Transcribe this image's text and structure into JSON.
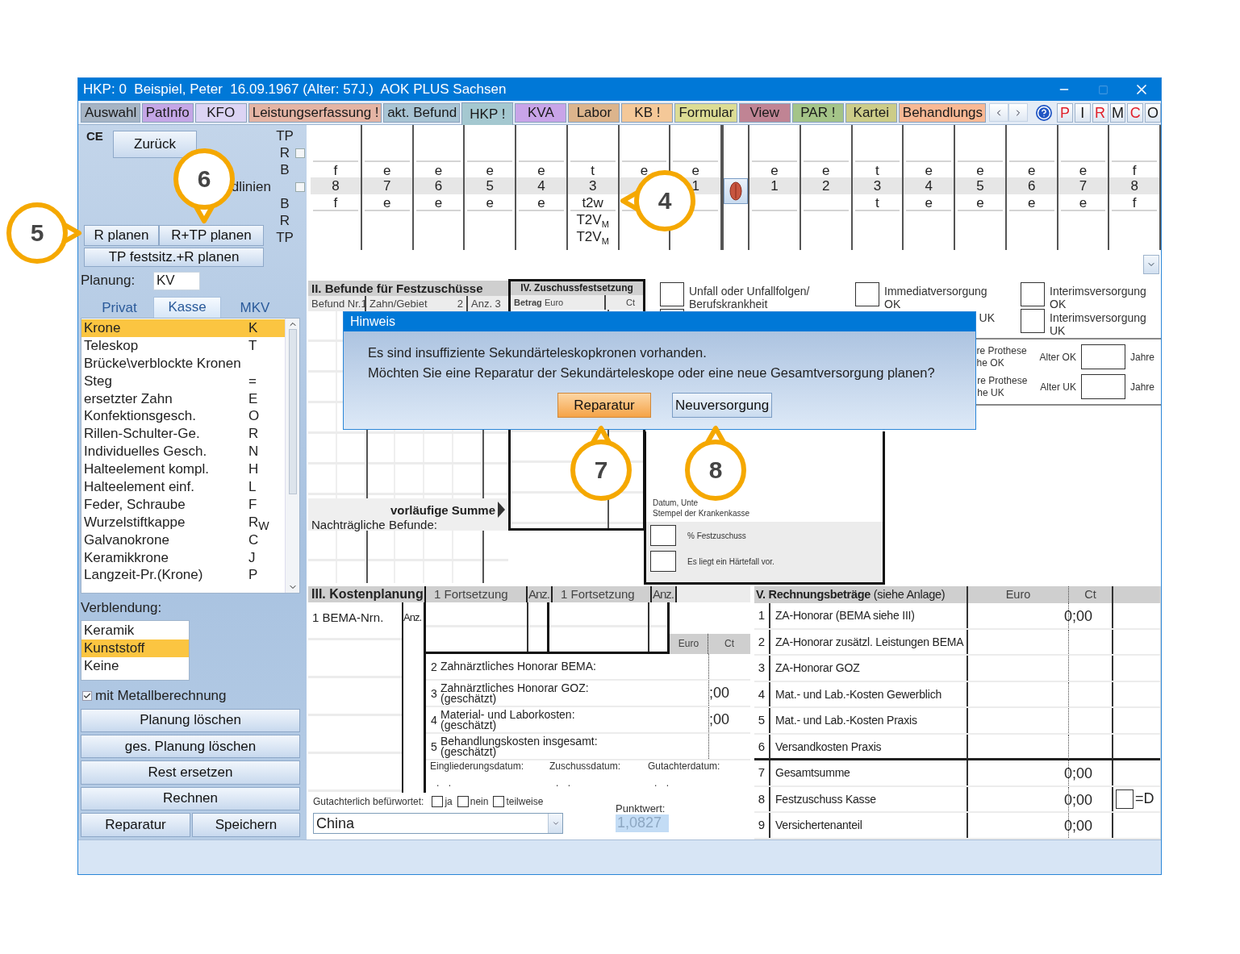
{
  "window": {
    "title": "HKP: 0  Beispiel, Peter  16.09.1967 (Alter: 57J.)  AOK PLUS Sachsen"
  },
  "tabs": [
    {
      "label": "Auswahl",
      "color": "#a6b4c4",
      "selected": false
    },
    {
      "label": "PatInfo",
      "color": "#c4a6e6",
      "selected": false
    },
    {
      "label": "KFO",
      "color": "#dcd4f4",
      "selected": false
    },
    {
      "label": "Leistungserfassung !",
      "color": "#e4b4a4",
      "selected": false
    },
    {
      "label": "akt. Befund",
      "color": "#a8c4d4",
      "selected": false
    },
    {
      "label": "HKP !",
      "color": "#a4c8d0",
      "selected": true
    },
    {
      "label": "KVA",
      "color": "#c8a4e8",
      "selected": false
    },
    {
      "label": "Labor",
      "color": "#dcb48c",
      "selected": false
    },
    {
      "label": "KB !",
      "color": "#f4c898",
      "selected": false
    },
    {
      "label": "Formular",
      "color": "#dcdc94",
      "selected": false
    },
    {
      "label": "View",
      "color": "#c08494",
      "selected": false
    },
    {
      "label": "PAR !",
      "color": "#a4c488",
      "selected": false
    },
    {
      "label": "Kartei",
      "color": "#cccc88",
      "selected": false
    },
    {
      "label": "Behandlungs",
      "color": "#f8b894",
      "selected": false
    }
  ],
  "quick_buttons": [
    {
      "label": "P",
      "color": "#e0202a"
    },
    {
      "label": "I",
      "color": "#1a1a1a"
    },
    {
      "label": "R",
      "color": "#e0202a"
    },
    {
      "label": "M",
      "color": "#1a1a1a"
    },
    {
      "label": "C",
      "color": "#e0202a"
    },
    {
      "label": "O",
      "color": "#1a1a1a"
    }
  ],
  "left_panel": {
    "ce_mark": "CE",
    "back_button": "Zurück",
    "side_labels_top": [
      "TP",
      "R",
      "B"
    ],
    "guide_lines": "dlinien",
    "side_labels_bottom": [
      "B",
      "R",
      "TP"
    ],
    "row_checks": [
      {
        "checked": false
      },
      {
        "checked": false
      }
    ],
    "plan_buttons": [
      "R planen",
      "R+TP planen"
    ],
    "plan_wide_button": "TP festsitz.+R planen",
    "planung": {
      "label": "Planung:",
      "value": "KV"
    },
    "payer_tabs": [
      {
        "label": "Privat",
        "selected": false
      },
      {
        "label": "Kasse",
        "selected": true
      },
      {
        "label": "MKV",
        "selected": false
      }
    ],
    "crown_types": [
      {
        "label": "Krone",
        "code": "K",
        "selected": true
      },
      {
        "label": "Teleskop",
        "code": "T",
        "selected": false
      },
      {
        "label": "Brücke\\verblockte Kronen",
        "selected": false
      },
      {
        "label": "Steg",
        "code": "=",
        "selected": false
      },
      {
        "label": "ersetzter Zahn",
        "code": "E",
        "selected": false
      },
      {
        "label": "Konfektionsgesch.",
        "code": "O",
        "selected": false
      },
      {
        "label": "Rillen-Schulter-Ge.",
        "code": "R",
        "selected": false
      },
      {
        "label": "Individuelles Gesch.",
        "code": "N",
        "selected": false
      },
      {
        "label": "Halteelement kompl.",
        "code": "H",
        "selected": false
      },
      {
        "label": "Halteelement einf.",
        "code": "L",
        "selected": false
      },
      {
        "label": "Feder, Schraube",
        "code": "F",
        "selected": false
      },
      {
        "label": "Wurzelstiftkappe",
        "code": "R$_{W}$",
        "selected": false
      },
      {
        "label": "Galvanokrone",
        "code": "C",
        "selected": false
      },
      {
        "label": "Keramikkrone",
        "code": "J",
        "selected": false
      },
      {
        "label": "Langzeit-Pr.(Krone)",
        "code": "P",
        "selected": false
      }
    ],
    "veneer": {
      "label": "Verblendung:",
      "options": [
        {
          "label": "Keramik",
          "selected": false
        },
        {
          "label": "Kunststoff",
          "selected": true
        },
        {
          "label": "Keine",
          "selected": false
        }
      ]
    },
    "metal": {
      "label": "mit Metallberechnung",
      "checked": true
    },
    "action_buttons": [
      "Planung löschen",
      "ges. Planung löschen",
      "Rest ersetzen",
      "Rechnen"
    ],
    "bottom_buttons": [
      "Reparatur",
      "Speichern"
    ]
  },
  "tooth_chart": {
    "left": [
      {
        "upper": "f",
        "number": "8",
        "lower": "f"
      },
      {
        "upper": "e",
        "number": "7",
        "lower": "e"
      },
      {
        "upper": "e",
        "number": "6",
        "lower": "e"
      },
      {
        "upper": "e",
        "number": "5",
        "lower": "e"
      },
      {
        "upper": "e",
        "number": "4",
        "lower": "e"
      },
      {
        "upper": "t",
        "number": "3",
        "lower": "t2w",
        "plan": [
          "T2V$_{M}$",
          "T2V$_{M}$"
        ]
      },
      {
        "upper": "e"
      },
      {
        "upper": "e",
        "number": "1"
      }
    ],
    "right": [
      {
        "upper": "e",
        "number": "1"
      },
      {
        "upper": "e",
        "number": "2"
      },
      {
        "upper": "t",
        "number": "3",
        "lower": "t"
      },
      {
        "upper": "e",
        "number": "4",
        "lower": "e"
      },
      {
        "upper": "e",
        "number": "5",
        "lower": "e"
      },
      {
        "upper": "e",
        "number": "6",
        "lower": "e"
      },
      {
        "upper": "e",
        "number": "7",
        "lower": "e"
      },
      {
        "upper": "f",
        "number": "8",
        "lower": "f"
      }
    ]
  },
  "findings": {
    "title": "II. Befunde für Festzuschüsse",
    "columns": [
      "Befund Nr.1",
      "Zahn/Gebiet",
      "2",
      "Anz. 3"
    ],
    "subtotal": "vorläufige Summe",
    "later": "Nachträgliche Befunde:"
  },
  "subsidy": {
    "title": "IV. Zuschussfestsetzung",
    "columns": [
      "Betrag",
      "Euro",
      "Ct"
    ],
    "stamp_lines": [
      "Datum, Unte",
      "Stempel der Krankenkasse"
    ],
    "percent_sign": "%",
    "percent_label": "Festzuschuss",
    "hardship": {
      "label": "Es liegt ein Härtefall vor.",
      "checked": false
    }
  },
  "flags": {
    "accident": {
      "label": "Unfall oder Unfallfolgen/ Berufskrankheit",
      "checked": false
    },
    "immediate_ok": {
      "label": "Immediatversorgung OK",
      "checked": false
    },
    "interim_ok": {
      "label": "Interimsversorgung OK",
      "checked": false
    },
    "second_row": {
      "checked": false
    },
    "immediate_uk": "UK",
    "interim_uk": {
      "label": "Interimsversorgung UK",
      "checked": false
    }
  },
  "prosthesis_age": [
    {
      "note": [
        "re Prothese",
        "he OK"
      ],
      "label": "Alter OK",
      "unit": "Jahre"
    },
    {
      "note": [
        "re Prothese",
        "he UK"
      ],
      "label": "Alter UK",
      "unit": "Jahre"
    }
  ],
  "cost_planning": {
    "title": "III. Kostenplanung",
    "continuations": [
      {
        "label": "1 Fortsetzung",
        "count": "Anz."
      },
      {
        "label": "1 Fortsetzung",
        "count": "Anz."
      }
    ],
    "bema": "1 BEMA-Nrn.",
    "count": "Anz.",
    "currency": [
      "Euro",
      "Ct"
    ],
    "rows": [
      {
        "num": "2",
        "label": "Zahnärztliches Honorar BEMA:"
      },
      {
        "num": "3",
        "label": "Zahnärztliches Honorar GOZ:",
        "note": "(geschätzt)",
        "value": ";00"
      },
      {
        "num": "4",
        "label": "Material- und Laborkosten:",
        "note": "(geschätzt)",
        "value": ";00"
      },
      {
        "num": "5",
        "label": "Behandlungskosten insgesamt:",
        "note": "(geschätzt)"
      }
    ],
    "dates": [
      {
        "label": "Eingliederungsdatum:",
        "value": ". ."
      },
      {
        "label": "Zuschussdatum:",
        "value": ". ."
      },
      {
        "label": "Gutachterdatum:",
        "value": ". ."
      }
    ],
    "approval": {
      "label": "Gutachterlich befürwortet:",
      "options": [
        {
          "label": "ja",
          "checked": false
        },
        {
          "label": "nein",
          "checked": false
        },
        {
          "label": "teilweise",
          "checked": false
        }
      ]
    },
    "country": "China",
    "point_value": {
      "label": "Punktwert:",
      "value": "1,0827"
    }
  },
  "billing": {
    "title": "V. Rechnungsbeträge",
    "subtitle": "(siehe Anlage)",
    "columns": [
      "Euro",
      "Ct"
    ],
    "rows": [
      {
        "num": "1",
        "label": "ZA-Honorar (BEMA siehe III)",
        "amount": "0;00"
      },
      {
        "num": "2",
        "label": "ZA-Honorar zusätzl. Leistungen BEMA"
      },
      {
        "num": "3",
        "label": "ZA-Honorar GOZ"
      },
      {
        "num": "4",
        "label": "Mat.- und Lab.-Kosten Gewerblich"
      },
      {
        "num": "5",
        "label": "Mat.- und Lab.-Kosten Praxis"
      },
      {
        "num": "6",
        "label": "Versandkosten Praxis"
      },
      {
        "num": "7",
        "label": "Gesamtsumme",
        "amount": "0;00"
      },
      {
        "num": "8",
        "label": "Festzuschuss Kasse",
        "amount": "0;00",
        "flag": {
          "label": "=D",
          "checked": false
        }
      },
      {
        "num": "9",
        "label": "Versichertenanteil",
        "amount": "0;00"
      }
    ]
  },
  "dialog": {
    "title": "Hinweis",
    "lines": [
      "Es sind insuffiziente Sekundärteleskopkronen vorhanden.",
      "Möchten Sie eine Reparatur der Sekundärteleskope oder eine neue Gesamtversorgung planen?"
    ],
    "buttons": [
      {
        "label": "Reparatur",
        "selected": true
      },
      {
        "label": "Neuversorgung",
        "selected": false
      }
    ]
  },
  "callouts": [
    {
      "number": "4"
    },
    {
      "number": "5"
    },
    {
      "number": "6"
    },
    {
      "number": "7"
    },
    {
      "number": "8"
    }
  ]
}
